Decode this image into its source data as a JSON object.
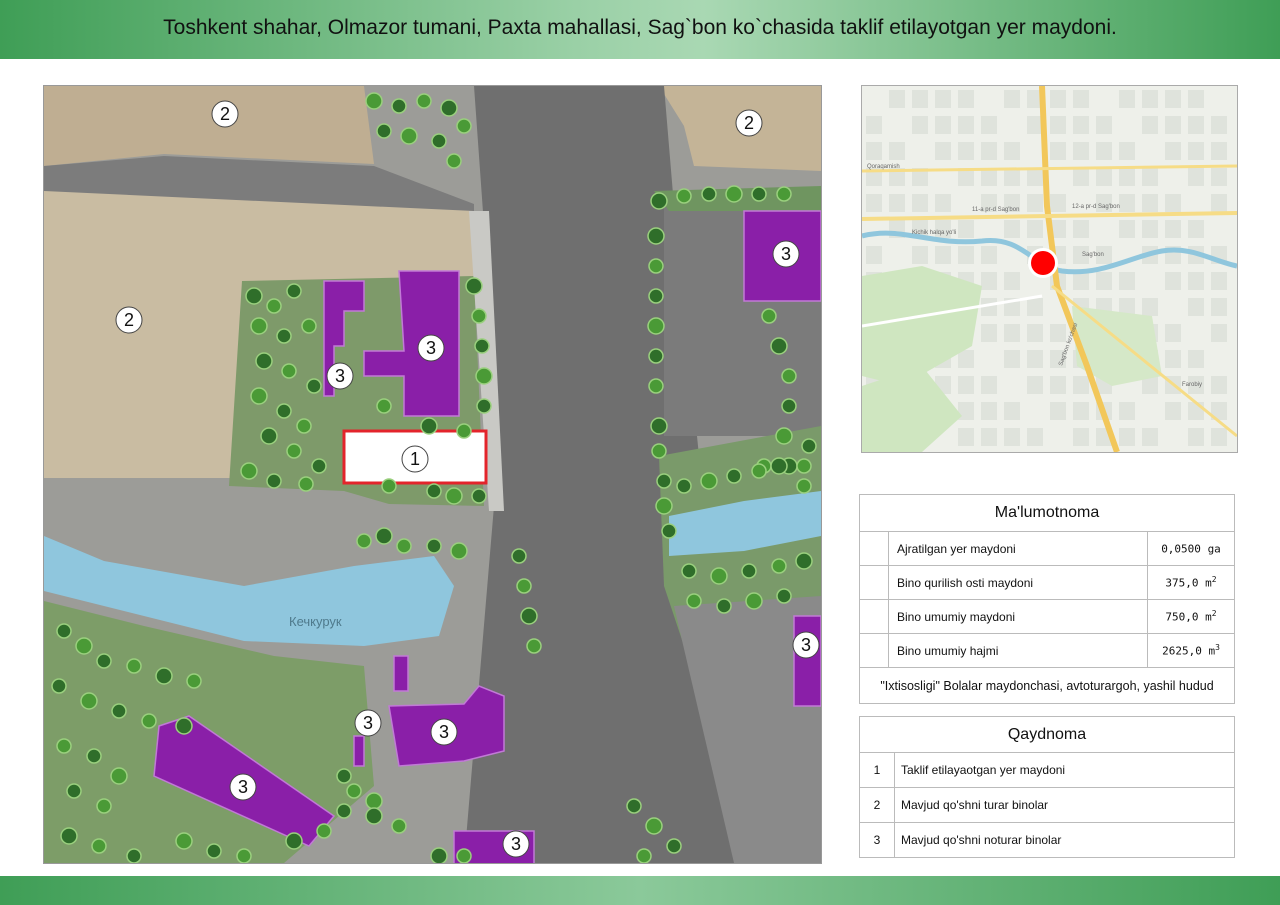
{
  "header": {
    "title": "Toshkent shahar, Olmazor tumani, Paxta mahallasi, Sag`bon ko`chasida taklif etilayotgan yer maydoni."
  },
  "map": {
    "river_label": "Кечкурук",
    "plot_marker": "1",
    "residential_marker": "2",
    "nonresidential_marker": "3"
  },
  "locator": {
    "labels": [
      "Qoraqamish",
      "11-a pr-d Sag'bon",
      "12-a pr-d Sag'bon",
      "Sag'bon",
      "Kichik halqa yo'li",
      "Sag'bon ko'chasi",
      "Farobiy"
    ]
  },
  "info": {
    "title": "Ma'lumotnoma",
    "rows": [
      {
        "label": "Ajratilgan yer maydoni",
        "value": "0,0500",
        "unit": "ga",
        "sup": ""
      },
      {
        "label": "Bino qurilish osti maydoni",
        "value": "375,0",
        "unit": "m",
        "sup": "2"
      },
      {
        "label": "Bino umumiy maydoni",
        "value": "750,0",
        "unit": "m",
        "sup": "2"
      },
      {
        "label": "Bino umumiy hajmi",
        "value": "2625,0",
        "unit": "m",
        "sup": "3"
      }
    ],
    "footer": "\"Ixtisosligi\" Bolalar maydonchasi, avtoturargoh, yashil hudud"
  },
  "legend": {
    "title": "Qaydnoma",
    "items": [
      {
        "num": "1",
        "label": "Taklif etilayaotgan yer maydoni"
      },
      {
        "num": "2",
        "label": "Mavjud qo'shni turar binolar"
      },
      {
        "num": "3",
        "label": "Mavjud qo'shni noturar binolar"
      }
    ]
  },
  "colors": {
    "header_green": "#3f9e56",
    "building_purple": "#8a1fa8",
    "road_gray": "#8a8a8a",
    "canal_blue": "#8fc6dd",
    "plot_red": "#e3242b",
    "tree_green": "#4a9a36"
  }
}
